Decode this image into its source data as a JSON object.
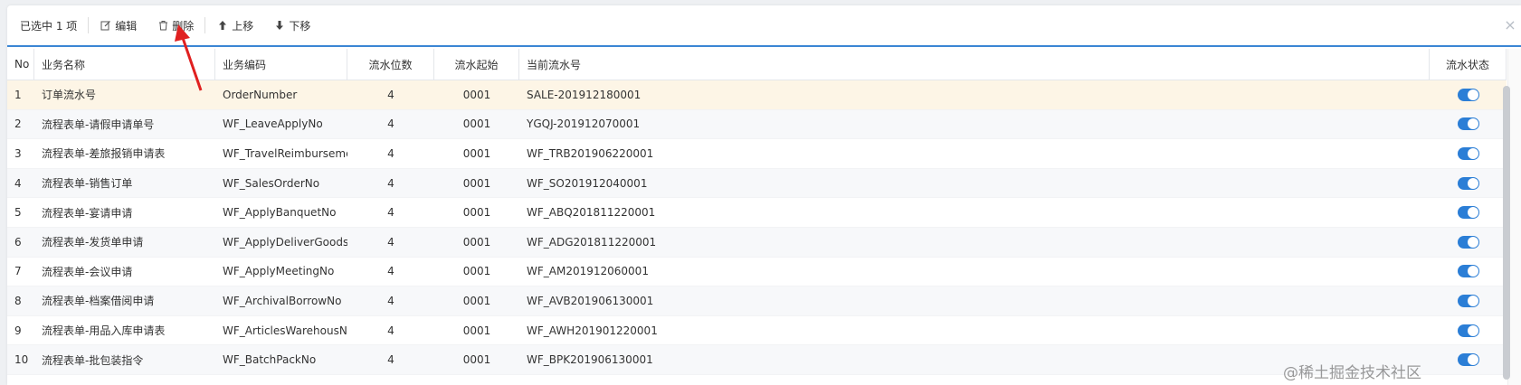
{
  "toolbar": {
    "selected_text": "已选中 1 项",
    "edit_label": "编辑",
    "delete_label": "删除",
    "move_up_label": "上移",
    "move_down_label": "下移"
  },
  "table": {
    "headers": {
      "no": "No",
      "name": "业务名称",
      "code": "业务编码",
      "length": "流水位数",
      "start": "流水起始",
      "current": "当前流水号",
      "status": "流水状态"
    },
    "rows": [
      {
        "no": "1",
        "name": "订单流水号",
        "code": "OrderNumber",
        "length": "4",
        "start": "0001",
        "current": "SALE-201912180001",
        "status": "on"
      },
      {
        "no": "2",
        "name": "流程表单-请假申请单号",
        "code": "WF_LeaveApplyNo",
        "length": "4",
        "start": "0001",
        "current": "YGQJ-201912070001",
        "status": "on"
      },
      {
        "no": "3",
        "name": "流程表单-差旅报销申请表",
        "code": "WF_TravelReimbursement",
        "length": "4",
        "start": "0001",
        "current": "WF_TRB201906220001",
        "status": "on"
      },
      {
        "no": "4",
        "name": "流程表单-销售订单",
        "code": "WF_SalesOrderNo",
        "length": "4",
        "start": "0001",
        "current": "WF_SO201912040001",
        "status": "on"
      },
      {
        "no": "5",
        "name": "流程表单-宴请申请",
        "code": "WF_ApplyBanquetNo",
        "length": "4",
        "start": "0001",
        "current": "WF_ABQ201811220001",
        "status": "on"
      },
      {
        "no": "6",
        "name": "流程表单-发货单申请",
        "code": "WF_ApplyDeliverGoodsNo",
        "length": "4",
        "start": "0001",
        "current": "WF_ADG201811220001",
        "status": "on"
      },
      {
        "no": "7",
        "name": "流程表单-会议申请",
        "code": "WF_ApplyMeetingNo",
        "length": "4",
        "start": "0001",
        "current": "WF_AM201912060001",
        "status": "on"
      },
      {
        "no": "8",
        "name": "流程表单-档案借阅申请",
        "code": "WF_ArchivalBorrowNo",
        "length": "4",
        "start": "0001",
        "current": "WF_AVB201906130001",
        "status": "on"
      },
      {
        "no": "9",
        "name": "流程表单-用品入库申请表",
        "code": "WF_ArticlesWarehousNo",
        "length": "4",
        "start": "0001",
        "current": "WF_AWH201901220001",
        "status": "on"
      },
      {
        "no": "10",
        "name": "流程表单-批包装指令",
        "code": "WF_BatchPackNo",
        "length": "4",
        "start": "0001",
        "current": "WF_BPK201906130001",
        "status": "on"
      }
    ]
  },
  "watermark": "@稀土掘金技术社区",
  "colors": {
    "accent": "#2b7ed6",
    "selected_row": "#fdf5e6",
    "annotation_arrow": "#e02020"
  }
}
